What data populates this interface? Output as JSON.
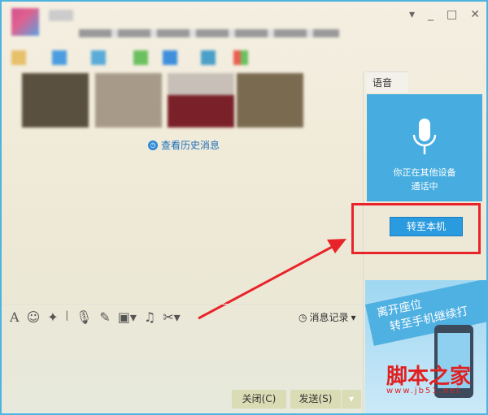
{
  "window": {
    "controls": [
      "▾",
      "_",
      "□",
      "✕"
    ]
  },
  "history_link": "查看历史消息",
  "voice_panel": {
    "tab": "语音",
    "status_line1": "你正在其他设备",
    "status_line2": "通话中",
    "switch_button": "转至本机"
  },
  "toolbar": {
    "icons": [
      "font-icon",
      "emoji-icon",
      "magic-icon",
      "shake-icon",
      "voice-icon",
      "edit-icon",
      "image-icon",
      "music-icon",
      "screenshot-icon"
    ],
    "record_label": "消息记录"
  },
  "buttons": {
    "close": "关闭(C)",
    "send": "发送(S)"
  },
  "ad": {
    "line1": "离开座位",
    "line2": "转至手机继续打"
  },
  "watermark": {
    "text": "脚本之家",
    "url": "www.jb51.net"
  },
  "colors": {
    "accent": "#47ade0",
    "highlight": "#e8242a"
  }
}
